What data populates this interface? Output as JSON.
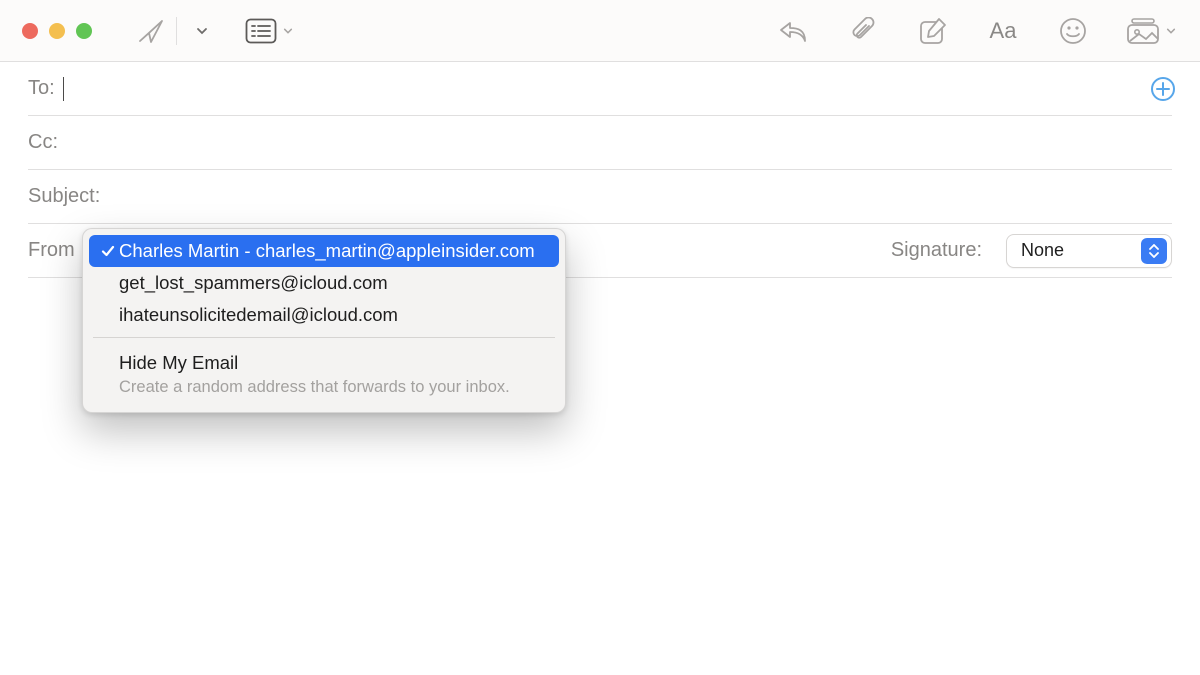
{
  "toolbar": {
    "icons": {
      "send": "paper-plane",
      "header_fields": "list-box",
      "reply": "reply-arrow",
      "attach": "paperclip",
      "markup": "compose-square",
      "format": "Aa",
      "emoji": "smiley",
      "photos": "photo-stack"
    }
  },
  "fields": {
    "to": {
      "label": "To:",
      "value": ""
    },
    "cc": {
      "label": "Cc:",
      "value": ""
    },
    "subject": {
      "label": "Subject:",
      "value": ""
    },
    "from": {
      "label": "From"
    },
    "signature": {
      "label": "Signature:",
      "value": "None"
    }
  },
  "from_menu": {
    "options": [
      {
        "label": "Charles Martin - charles_martin@appleinsider.com",
        "selected": true
      },
      {
        "label": "get_lost_spammers@icloud.com",
        "selected": false
      },
      {
        "label": "ihateunsolicitedemail@icloud.com",
        "selected": false
      }
    ],
    "hide_my_email": {
      "title": "Hide My Email",
      "subtitle": "Create a random address that forwards to your inbox."
    }
  },
  "colors": {
    "accent": "#2a6ff0",
    "add_contact": "#57a6ea",
    "traffic": {
      "close": "#ed6a5e",
      "minimize": "#f4bf4f",
      "zoom": "#61c554"
    }
  }
}
